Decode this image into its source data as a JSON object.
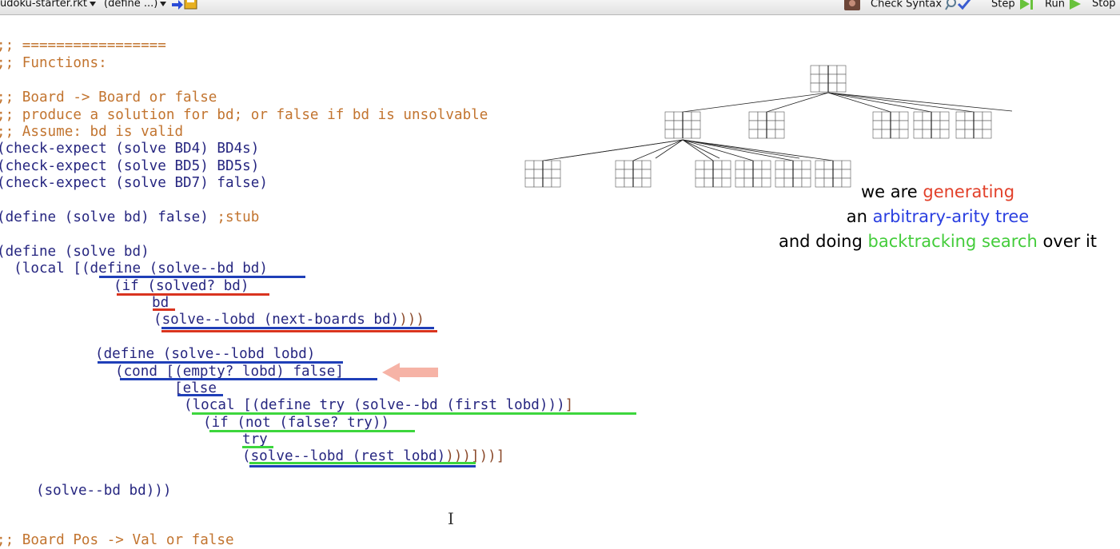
{
  "toolbar": {
    "filename": "udoku-starter.rkt",
    "define_menu": "(define ...)",
    "check_syntax": "Check Syntax",
    "step": "Step",
    "run": "Run",
    "stop": "Stop",
    "icons": [
      "save-arrow-icon",
      "user-avatar-icon",
      "magnifier-check-icon",
      "step-icon",
      "run-icon"
    ]
  },
  "code": {
    "l01": ";; =================",
    "l02": ";; Functions:",
    "l03": ";; Board -> Board or false",
    "l04": ";; produce a solution for bd; or false if bd is unsolvable",
    "l05": ";; Assume: bd is valid",
    "l06": "(check-expect (solve BD4) BD4s)",
    "l07": "(check-expect (solve BD5) BD5s)",
    "l08": "(check-expect (solve BD7) false)",
    "l09a": "(define (solve bd) false) ",
    "l09b": ";stub",
    "l10": "(define (solve bd)",
    "l11a": "  (local [",
    "l11b": "(define (solve--bd bd)",
    "l12": "(if (solved? bd)",
    "l13": "bd",
    "l14a": "(solve--lobd (next-boards bd)",
    "l14b": ")))",
    "l15": "(define (solve--lobd lobd)",
    "l16": "(cond [(empty? lobd) false]",
    "l17": "[else",
    "l18a": "(local [(define try (solve--bd (first lobd)))",
    "l18b": "]",
    "l19": "(if (not (false? try))",
    "l20": "try",
    "l21a": "(solve--lobd (rest lobd)",
    "l21b": ")))]))]",
    "l22": "(solve--bd bd)))",
    "l23": ";; Board Pos -> Val or false"
  },
  "annotation": {
    "line1_a": "we are ",
    "line1_b": "generating",
    "line2_a": "an ",
    "line2_b": "arbitrary-arity tree",
    "line3_a": "and doing ",
    "line3_b": "backtracking search",
    "line3_c": " over it"
  },
  "colors": {
    "comment": "#c2742f",
    "code": "#262680",
    "paren": "#8b4a2b",
    "underline_blue": "#1f3fb8",
    "underline_red": "#d9341f",
    "underline_green": "#3dd63d",
    "arrow": "#f6b3a6"
  }
}
